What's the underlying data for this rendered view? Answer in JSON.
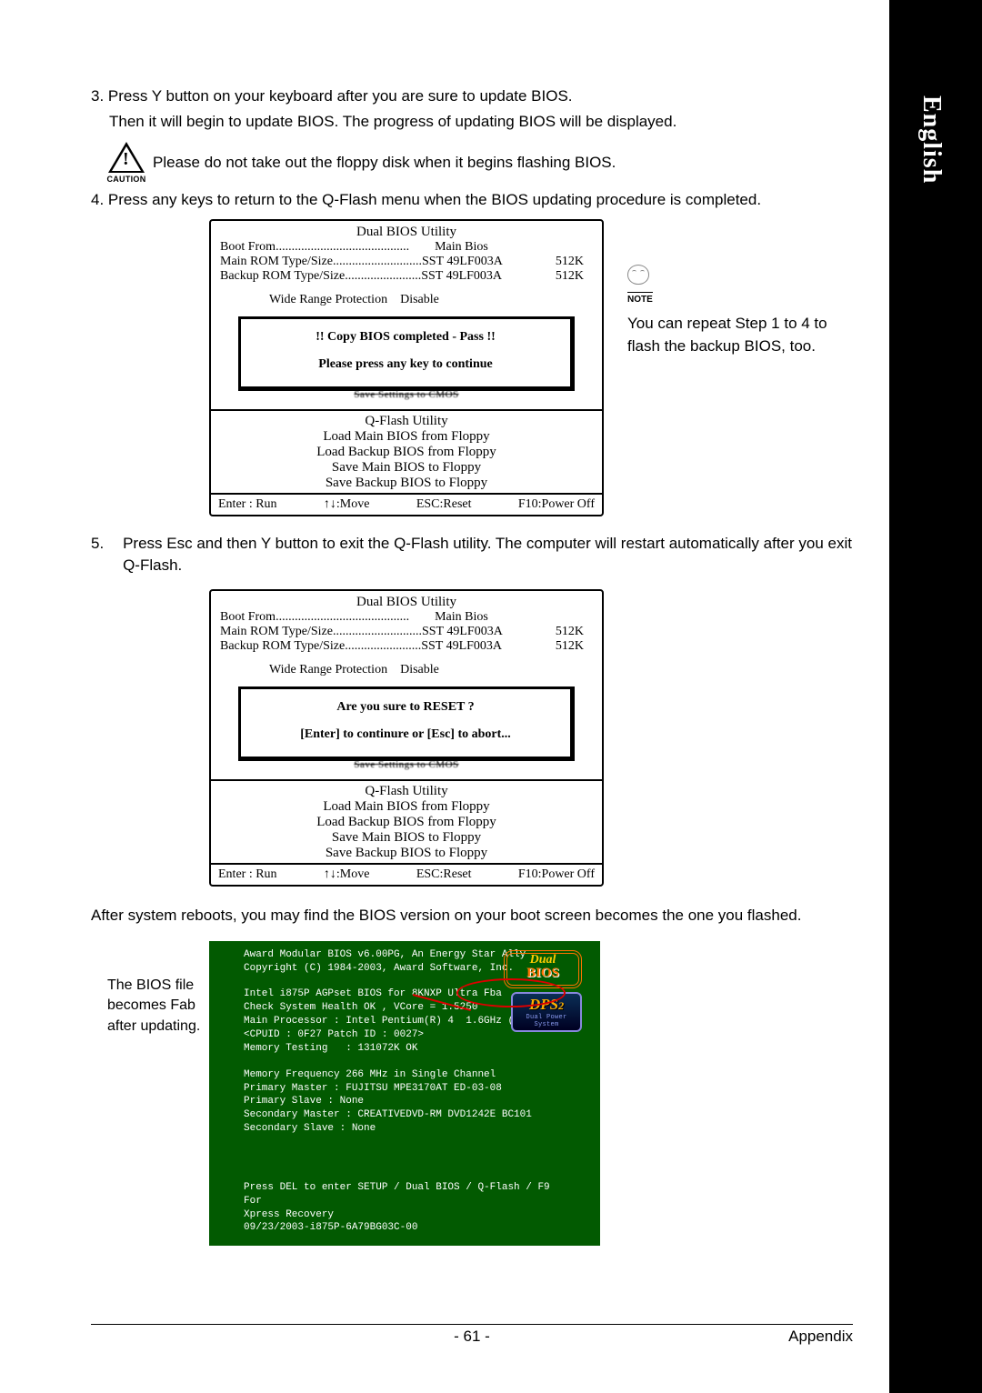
{
  "language_tab": "English",
  "step3_a": "3. Press Y button on your keyboard after you are sure to update BIOS.",
  "step3_b": "Then it will begin to update BIOS. The progress of updating BIOS will be displayed.",
  "caution_label": "CAUTION",
  "caution_text": "Please do not take out the floppy disk when it begins flashing BIOS.",
  "step4": "4. Press any keys to return to the Q-Flash menu when the BIOS updating procedure is completed.",
  "bios": {
    "title": "Dual BIOS Utility",
    "boot_from_label": "Boot From..........................................",
    "boot_from_value": "Main Bios",
    "main_rom_label": "Main ROM Type/Size............................",
    "main_rom_value": "SST 49LF003A",
    "main_rom_size": "512K",
    "backup_rom_label": "Backup ROM Type/Size........................",
    "backup_rom_value": "SST 49LF003A",
    "backup_rom_size": "512K",
    "wide_range": "Wide Range Protection",
    "wide_range_value": "Disable",
    "qflash_title": "Q-Flash Utility",
    "menu": [
      "Load Main BIOS from Floppy",
      "Load Backup BIOS from Floppy",
      "Save Main BIOS to Floppy",
      "Save Backup BIOS to Floppy"
    ],
    "foot_enter": "Enter : Run",
    "foot_move": "↑↓:Move",
    "foot_esc": "ESC:Reset",
    "foot_f10": "F10:Power Off",
    "obscured": "Save Settings to CMOS"
  },
  "msg1_a": "!! Copy BIOS completed - Pass !!",
  "msg1_b": "Please press any key to continue",
  "msg2_a": "Are you sure to RESET ?",
  "msg2_b": "[Enter] to continure or [Esc] to abort...",
  "note_label": "NOTE",
  "note_text": "You can repeat Step 1 to 4 to flash the backup BIOS, too.",
  "step5_num": "5.",
  "step5": "Press Esc and then Y button to exit the Q-Flash utility. The computer will restart automatically after you exit Q-Flash.",
  "after_reboot": "After system reboots, you may find the BIOS version on your boot screen becomes the one you flashed.",
  "side_caption": "The BIOS file becomes Fab after updating.",
  "post": {
    "l1": "Award Modular BIOS v6.00PG, An Energy Star Ally",
    "l2": "Copyright (C) 1984-2003, Award Software, Inc.",
    "l3": "Intel i875P AGPset BIOS for 8KNXP Ultra Fba",
    "l4": "Check System Health OK , VCore = 1.5250",
    "l5": "Main Processor : Intel Pentium(R) 4  1.6GHz (133x12)",
    "l6": "<CPUID : 0F27 Patch ID : 0027>",
    "l7": "Memory Testing   : 131072K OK",
    "l8": "Memory Frequency 266 MHz in Single Channel",
    "l9": "Primary Master : FUJITSU MPE3170AT ED-03-08",
    "l10": "Primary Slave : None",
    "l11": "Secondary Master : CREATIVEDVD-RM DVD1242E BC101",
    "l12": "Secondary Slave : None",
    "l13": "Press DEL to enter SETUP / Dual BIOS / Q-Flash / F9 For",
    "l14": "Xpress Recovery",
    "l15": "09/23/2003-i875P-6A79BG03C-00"
  },
  "dual_bios_1": "Dual",
  "dual_bios_2": "BIOS",
  "dps_txt": "DPS",
  "dps_sub": "Dual Power System",
  "page_num": "- 61 -",
  "appendix": "Appendix"
}
